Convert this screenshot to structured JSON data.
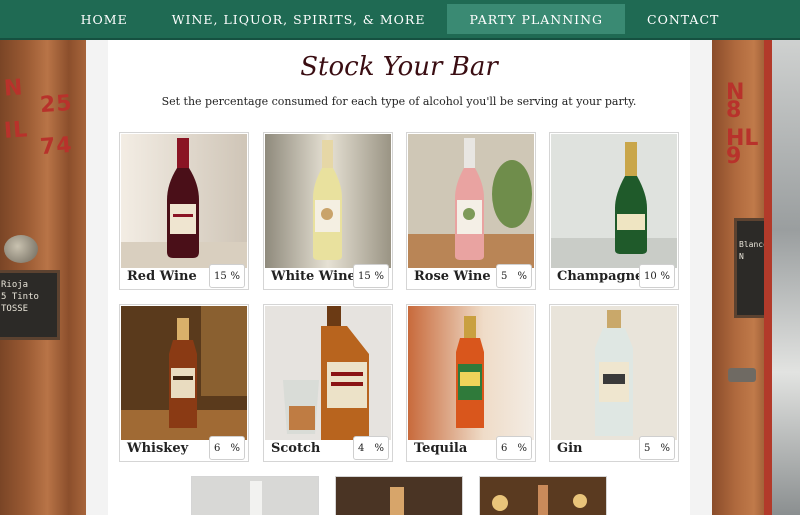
{
  "nav": {
    "items": [
      {
        "label": "HOME",
        "active": false
      },
      {
        "label": "WINE, LIQUOR, SPIRITS, & MORE",
        "active": false
      },
      {
        "label": "PARTY PLANNING",
        "active": true
      },
      {
        "label": "CONTACT",
        "active": false
      }
    ]
  },
  "page": {
    "title": "Stock Your Bar",
    "subtitle": "Set the percentage consumed for each type of alcohol you'll be serving at your party."
  },
  "drinks": [
    {
      "name": "Red Wine",
      "percent": "15",
      "unit": "%"
    },
    {
      "name": "White Wine",
      "percent": "15",
      "unit": "%"
    },
    {
      "name": "Rose Wine",
      "percent": "5",
      "unit": "%"
    },
    {
      "name": "Champagne",
      "percent": "10",
      "unit": "%"
    },
    {
      "name": "Whiskey",
      "percent": "6",
      "unit": "%"
    },
    {
      "name": "Scotch",
      "percent": "4",
      "unit": "%"
    },
    {
      "name": "Tequila",
      "percent": "6",
      "unit": "%"
    },
    {
      "name": "Gin",
      "percent": "5",
      "unit": "%"
    }
  ],
  "background": {
    "left_stencil": [
      "N",
      "25",
      "IL",
      "74"
    ],
    "left_slate": "Rioja\n5 Tinto\nTOSSE",
    "right_stencil": [
      "N",
      "8",
      "HL",
      "9"
    ],
    "right_slate": "Blanco\nN"
  },
  "colors": {
    "nav_bg": "#1f6a53",
    "nav_active": "#3a8a73",
    "title": "#3a0d12"
  }
}
